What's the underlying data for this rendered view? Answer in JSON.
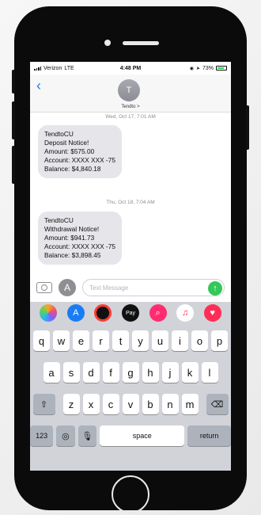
{
  "status": {
    "carrier": "Verizon",
    "network": "LTE",
    "time": "4:48 PM",
    "battery": "73%"
  },
  "header": {
    "avatar_initial": "T",
    "contact": "Tendto >"
  },
  "messages": [
    {
      "timestamp": "Wed, Oct 17, 7:01 AM",
      "lines": [
        "TendtoCU",
        "Deposit Notice!",
        "Amount: $575.00",
        "Account: XXXX XXX -75",
        "Balance: $4,840.18"
      ]
    },
    {
      "timestamp": "Thu, Oct 18, 7:04 AM",
      "lines": [
        "TendtoCU",
        "Withdrawal Notice!",
        "Amount: $941.73",
        "Account: XXXX XXX -75",
        "Balance: $3,898.45"
      ]
    }
  ],
  "composer": {
    "placeholder": "Text Message"
  },
  "app_drawer": [
    "photos",
    "app-store",
    "activity",
    "apple-pay",
    "search-images",
    "music",
    "heart-stickers"
  ],
  "keyboard": {
    "row1": [
      "q",
      "w",
      "e",
      "r",
      "t",
      "y",
      "u",
      "i",
      "o",
      "p"
    ],
    "row2": [
      "a",
      "s",
      "d",
      "f",
      "g",
      "h",
      "j",
      "k",
      "l"
    ],
    "row3": [
      "z",
      "x",
      "c",
      "v",
      "b",
      "n",
      "m"
    ],
    "numbers": "123",
    "space": "space",
    "return": "return"
  },
  "colors": {
    "accent": "#1a7cf5",
    "send": "#34c759",
    "bubble": "#e5e5ea"
  }
}
